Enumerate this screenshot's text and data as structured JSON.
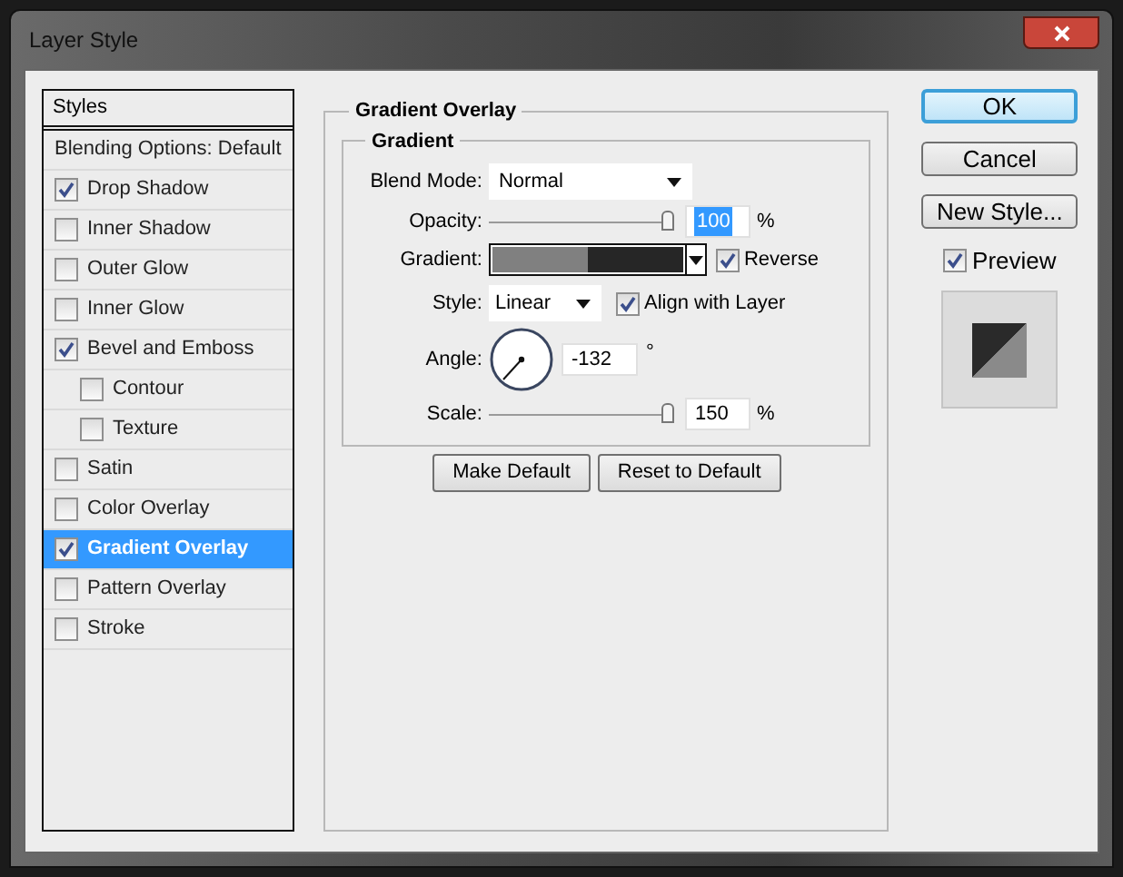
{
  "window": {
    "title": "Layer Style"
  },
  "styles_list": {
    "header": "Styles",
    "items": [
      {
        "label": "Blending Options: Default",
        "kind": "plain",
        "selected": false
      },
      {
        "label": "Drop Shadow",
        "kind": "check",
        "checked": true,
        "selected": false
      },
      {
        "label": "Inner Shadow",
        "kind": "check",
        "checked": false,
        "selected": false
      },
      {
        "label": "Outer Glow",
        "kind": "check",
        "checked": false,
        "selected": false
      },
      {
        "label": "Inner Glow",
        "kind": "check",
        "checked": false,
        "selected": false
      },
      {
        "label": "Bevel and Emboss",
        "kind": "check",
        "checked": true,
        "selected": false,
        "children": [
          {
            "label": "Contour",
            "kind": "check",
            "checked": false,
            "selected": false
          },
          {
            "label": "Texture",
            "kind": "check",
            "checked": false,
            "selected": false
          }
        ]
      },
      {
        "label": "Satin",
        "kind": "check",
        "checked": false,
        "selected": false
      },
      {
        "label": "Color Overlay",
        "kind": "check",
        "checked": false,
        "selected": false
      },
      {
        "label": "Gradient Overlay",
        "kind": "check",
        "checked": true,
        "selected": true
      },
      {
        "label": "Pattern Overlay",
        "kind": "check",
        "checked": false,
        "selected": false
      },
      {
        "label": "Stroke",
        "kind": "check",
        "checked": false,
        "selected": false
      }
    ]
  },
  "panel": {
    "title": "Gradient Overlay",
    "group": "Gradient",
    "blend_mode": {
      "label": "Blend Mode:",
      "value": "Normal"
    },
    "opacity": {
      "label": "Opacity:",
      "level": 1,
      "value": "100",
      "text_selected": true,
      "unit": "%"
    },
    "gradient": {
      "label": "Gradient:",
      "reverse": {
        "label": "Reverse",
        "checked": true
      }
    },
    "style": {
      "label": "Style:",
      "value": "Linear",
      "align": {
        "label": "Align with Layer",
        "checked": true
      }
    },
    "angle": {
      "label": "Angle:",
      "value": "-132",
      "unit": "°"
    },
    "scale": {
      "label": "Scale:",
      "level": 1,
      "value": "150",
      "unit": "%"
    },
    "buttons": [
      "Make Default",
      "Reset to Default"
    ]
  },
  "actions": {
    "buttons": [
      {
        "label": "OK",
        "default": true
      },
      {
        "label": "Cancel",
        "default": false
      },
      {
        "label": "New Style...",
        "default": false
      }
    ],
    "preview": {
      "label": "Preview",
      "checked": true
    }
  }
}
